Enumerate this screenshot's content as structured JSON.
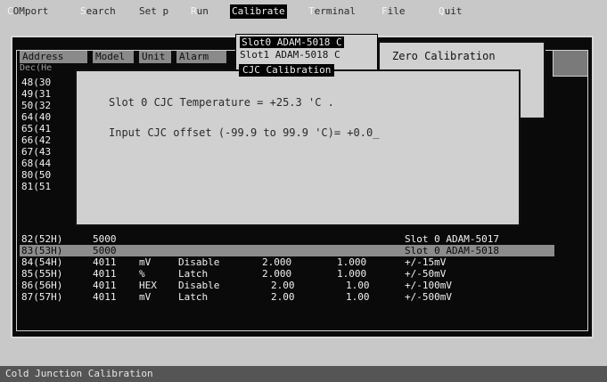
{
  "menu": [
    {
      "hot": "C",
      "rest": "OMport",
      "active": false
    },
    {
      "hot": "S",
      "rest": "earch",
      "active": false
    },
    {
      "hot": "",
      "rest": "Set p",
      "active": false
    },
    {
      "hot": "R",
      "rest": "un",
      "active": false
    },
    {
      "hot": "",
      "rest": "Calibrate",
      "active": true
    },
    {
      "hot": "T",
      "rest": "erminal",
      "active": false
    },
    {
      "hot": "F",
      "rest": "ile",
      "active": false
    },
    {
      "hot": "Q",
      "rest": "uit",
      "active": false
    }
  ],
  "table": {
    "headers": [
      "Address",
      "Model",
      "Unit",
      "Alarm"
    ],
    "subheader": "Dec(He",
    "partial_rows": [
      "48(30",
      "49(31",
      "50(32",
      "64(40",
      "65(41",
      "66(42",
      "67(43",
      "68(44",
      "80(50",
      "81(51"
    ],
    "rows": [
      {
        "address": "82(52H)",
        "model": "5000",
        "unit": "",
        "alarm": "",
        "v1": "",
        "v2": "",
        "desc": "Slot 0 ADAM-5017"
      },
      {
        "address": "83(53H)",
        "model": "5000",
        "unit": "",
        "alarm": "",
        "v1": "",
        "v2": "",
        "desc": "Slot 0 ADAM-5018"
      },
      {
        "address": "84(54H)",
        "model": "4011",
        "unit": "mV",
        "alarm": "Disable",
        "v1": "2.000",
        "v2": "1.000",
        "desc": "+/-15mV"
      },
      {
        "address": "85(55H)",
        "model": "4011",
        "unit": "%",
        "alarm": "Latch",
        "v1": "2.000",
        "v2": "1.000",
        "desc": "+/-50mV"
      },
      {
        "address": "86(56H)",
        "model": "4011",
        "unit": "HEX",
        "alarm": "Disable",
        "v1": "2.00",
        "v2": "1.00",
        "desc": "+/-100mV"
      },
      {
        "address": "87(57H)",
        "model": "4011",
        "unit": "mV",
        "alarm": "Latch",
        "v1": "2.00",
        "v2": "1.00",
        "desc": "+/-500mV"
      }
    ]
  },
  "slot_popup": {
    "items": [
      "Slot0  ADAM-5018 C",
      "Slot1  ADAM-5018 C"
    ]
  },
  "zero_popup": {
    "label": "Zero Calibration"
  },
  "cjc_dialog": {
    "title": "CJC Calibration",
    "temperature_line": "Slot 0 CJC Temperature = +25.3 'C .",
    "offset_line": "Input CJC offset (-99.9 to 99.9 'C)= +0.0_"
  },
  "status": {
    "text": "Cold Junction Calibration"
  }
}
